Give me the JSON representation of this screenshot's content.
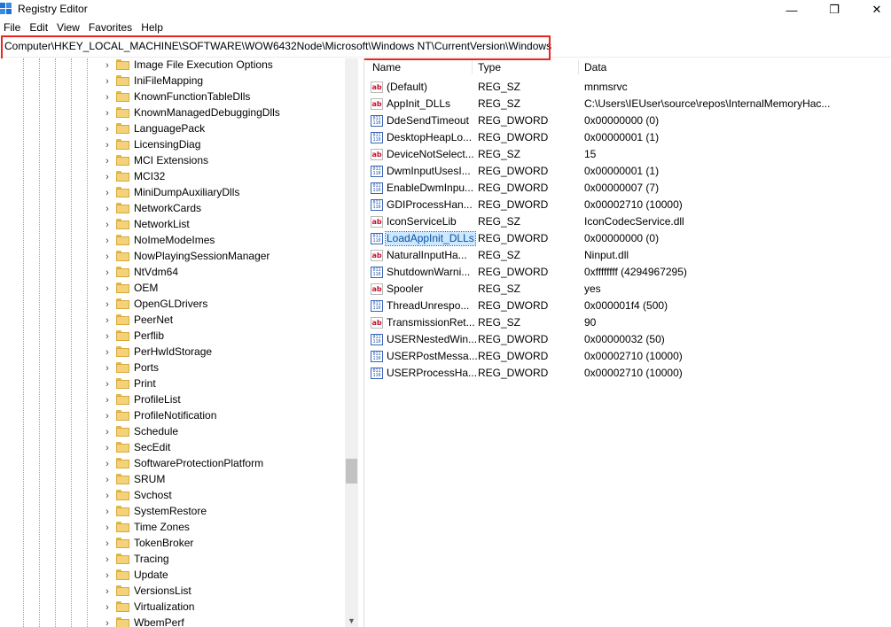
{
  "window": {
    "title": "Registry Editor",
    "minimize_glyph": "—",
    "restore_glyph": "❐",
    "close_glyph": "✕"
  },
  "menu": [
    "File",
    "Edit",
    "View",
    "Favorites",
    "Help"
  ],
  "address": "Computer\\HKEY_LOCAL_MACHINE\\SOFTWARE\\WOW6432Node\\Microsoft\\Windows NT\\CurrentVersion\\Windows",
  "colors": {
    "highlight_box": "#e8261e",
    "selection": "#cce8ff",
    "folder": "#f4d27a"
  },
  "tree": [
    "Image File Execution Options",
    "IniFileMapping",
    "KnownFunctionTableDlls",
    "KnownManagedDebuggingDlls",
    "LanguagePack",
    "LicensingDiag",
    "MCI Extensions",
    "MCI32",
    "MiniDumpAuxiliaryDlls",
    "NetworkCards",
    "NetworkList",
    "NoImeModeImes",
    "NowPlayingSessionManager",
    "NtVdm64",
    "OEM",
    "OpenGLDrivers",
    "PeerNet",
    "Perflib",
    "PerHwIdStorage",
    "Ports",
    "Print",
    "ProfileList",
    "ProfileNotification",
    "Schedule",
    "SecEdit",
    "SoftwareProtectionPlatform",
    "SRUM",
    "Svchost",
    "SystemRestore",
    "Time Zones",
    "TokenBroker",
    "Tracing",
    "Update",
    "VersionsList",
    "Virtualization",
    "WbemPerf"
  ],
  "tree_expander": "›",
  "scroll_down_glyph": "▼",
  "columns": {
    "name": "Name",
    "type": "Type",
    "data": "Data"
  },
  "values": [
    {
      "icon": "ab",
      "name": "(Default)",
      "type": "REG_SZ",
      "data": "mnmsrvc"
    },
    {
      "icon": "ab",
      "name": "AppInit_DLLs",
      "type": "REG_SZ",
      "data": "C:\\Users\\IEUser\\source\\repos\\InternalMemoryHac..."
    },
    {
      "icon": "bin",
      "name": "DdeSendTimeout",
      "type": "REG_DWORD",
      "data": "0x00000000 (0)"
    },
    {
      "icon": "bin",
      "name": "DesktopHeapLo...",
      "type": "REG_DWORD",
      "data": "0x00000001 (1)"
    },
    {
      "icon": "ab",
      "name": "DeviceNotSelect...",
      "type": "REG_SZ",
      "data": "15"
    },
    {
      "icon": "bin",
      "name": "DwmInputUsesI...",
      "type": "REG_DWORD",
      "data": "0x00000001 (1)"
    },
    {
      "icon": "bin",
      "name": "EnableDwmInpu...",
      "type": "REG_DWORD",
      "data": "0x00000007 (7)"
    },
    {
      "icon": "bin",
      "name": "GDIProcessHan...",
      "type": "REG_DWORD",
      "data": "0x00002710 (10000)"
    },
    {
      "icon": "ab",
      "name": "IconServiceLib",
      "type": "REG_SZ",
      "data": "IconCodecService.dll"
    },
    {
      "icon": "bin",
      "name": "LoadAppInit_DLLs",
      "type": "REG_DWORD",
      "data": "0x00000000 (0)",
      "selected": true
    },
    {
      "icon": "ab",
      "name": "NaturalInputHa...",
      "type": "REG_SZ",
      "data": "Ninput.dll"
    },
    {
      "icon": "bin",
      "name": "ShutdownWarni...",
      "type": "REG_DWORD",
      "data": "0xffffffff (4294967295)"
    },
    {
      "icon": "ab",
      "name": "Spooler",
      "type": "REG_SZ",
      "data": "yes"
    },
    {
      "icon": "bin",
      "name": "ThreadUnrespo...",
      "type": "REG_DWORD",
      "data": "0x000001f4 (500)"
    },
    {
      "icon": "ab",
      "name": "TransmissionRet...",
      "type": "REG_SZ",
      "data": "90"
    },
    {
      "icon": "bin",
      "name": "USERNestedWin...",
      "type": "REG_DWORD",
      "data": "0x00000032 (50)"
    },
    {
      "icon": "bin",
      "name": "USERPostMessa...",
      "type": "REG_DWORD",
      "data": "0x00002710 (10000)"
    },
    {
      "icon": "bin",
      "name": "USERProcessHa...",
      "type": "REG_DWORD",
      "data": "0x00002710 (10000)"
    }
  ]
}
